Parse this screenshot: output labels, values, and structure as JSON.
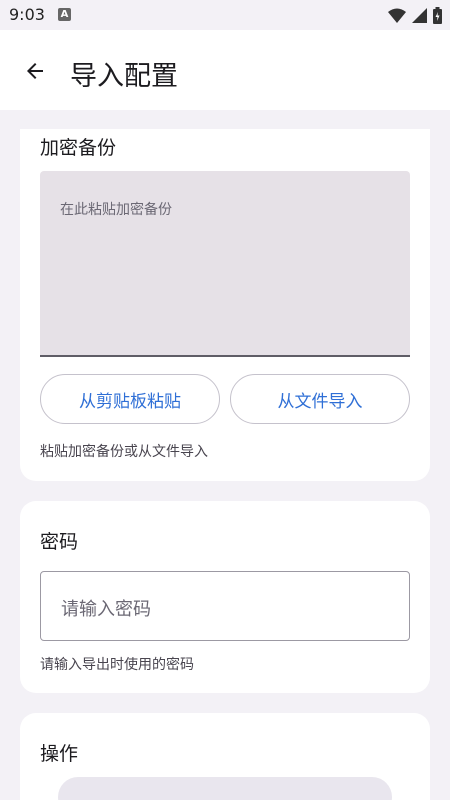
{
  "status_bar": {
    "time": "9:03",
    "badge": "A"
  },
  "app_bar": {
    "title": "导入配置"
  },
  "backup_card": {
    "title": "加密备份",
    "placeholder": "在此粘贴加密备份",
    "paste_button": "从剪贴板粘贴",
    "file_button": "从文件导入",
    "helper": "粘贴加密备份或从文件导入"
  },
  "password_card": {
    "title": "密码",
    "placeholder": "请输入密码",
    "helper": "请输入导出时使用的密码"
  },
  "actions_card": {
    "title": "操作"
  },
  "colors": {
    "accent": "#2f6fd6",
    "background": "#f3f1f6",
    "textarea_fill": "#e6e1e7"
  }
}
